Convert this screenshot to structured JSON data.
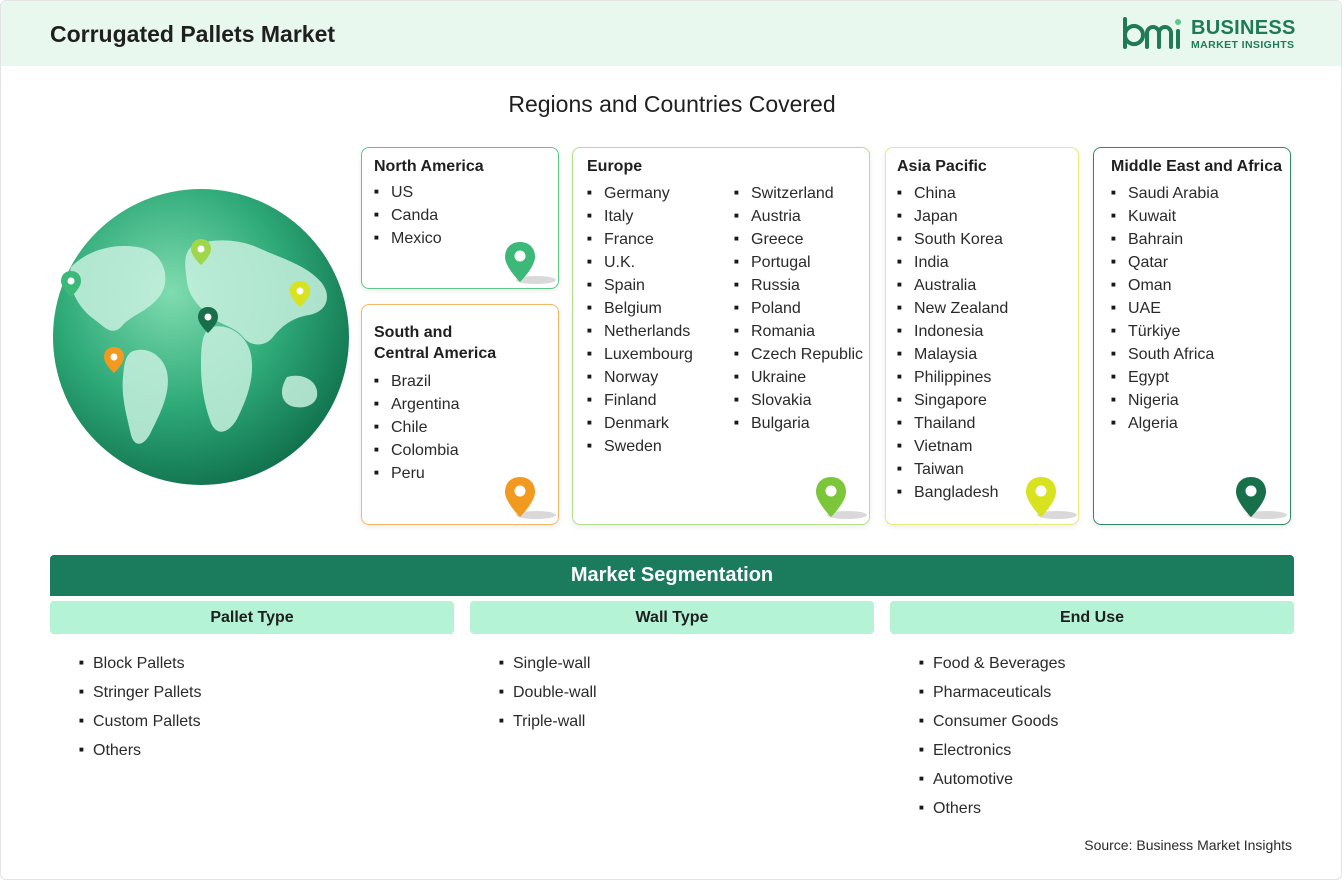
{
  "header": {
    "title": "Corrugated Pallets Market"
  },
  "logo": {
    "line1": "BUSINESS",
    "line2": "MARKET INSIGHTS",
    "brand_color": "#1f7a55"
  },
  "regions_title": "Regions and Countries Covered",
  "regions": [
    {
      "title": "North America",
      "color": "#5cc98a",
      "pin_color": "#3cb878",
      "items": [
        "US",
        "Canda",
        "Mexico"
      ]
    },
    {
      "title": "South and Central America",
      "title_lines": [
        "South and",
        "Central America"
      ],
      "color": "#f2b866",
      "pin_color": "#f29a1f",
      "items": [
        "Brazil",
        "Argentina",
        "Chile",
        "Colombia",
        "Peru"
      ]
    },
    {
      "title": "Europe",
      "color": "#b5e08a",
      "pin_color": "#7cc63a",
      "items_col1": [
        "Germany",
        "Italy",
        "France",
        "U.K.",
        "Spain",
        "Belgium",
        "Netherlands",
        "Luxembourg",
        "Norway",
        "Finland",
        "Denmark",
        "Sweden"
      ],
      "items_col2": [
        "Switzerland",
        "Austria",
        "Greece",
        "Portugal",
        "Russia",
        "Poland",
        "Romania",
        "Czech Republic",
        "Ukraine",
        "Slovakia",
        "Bulgaria"
      ]
    },
    {
      "title": "Asia Pacific",
      "color": "#e8ea7a",
      "pin_color": "#d8e21e",
      "items": [
        "China",
        "Japan",
        "South Korea",
        "India",
        "Australia",
        "New Zealand",
        "Indonesia",
        "Malaysia",
        "Philippines",
        "Singapore",
        "Thailand",
        "Vietnam",
        "Taiwan",
        "Bangladesh"
      ]
    },
    {
      "title": "Middle East and Africa",
      "color": "#2e8c62",
      "pin_color": "#17704a",
      "items": [
        "Saudi Arabia",
        "Kuwait",
        "Bahrain",
        "Qatar",
        "Oman",
        "UAE",
        "Türkiye",
        "South Africa",
        "Egypt",
        "Nigeria",
        "Algeria"
      ]
    }
  ],
  "segmentation": {
    "title": "Market Segmentation",
    "columns": [
      {
        "heading": "Pallet Type",
        "items": [
          "Block Pallets",
          "Stringer Pallets",
          "Custom Pallets",
          "Others"
        ]
      },
      {
        "heading": "Wall Type",
        "items": [
          "Single-wall",
          "Double-wall",
          "Triple-wall"
        ]
      },
      {
        "heading": "End Use",
        "items": [
          "Food & Beverages",
          "Pharmaceuticals",
          "Consumer Goods",
          "Electronics",
          "Automotive",
          "Others"
        ]
      }
    ]
  },
  "source": "Source: Business Market Insights"
}
